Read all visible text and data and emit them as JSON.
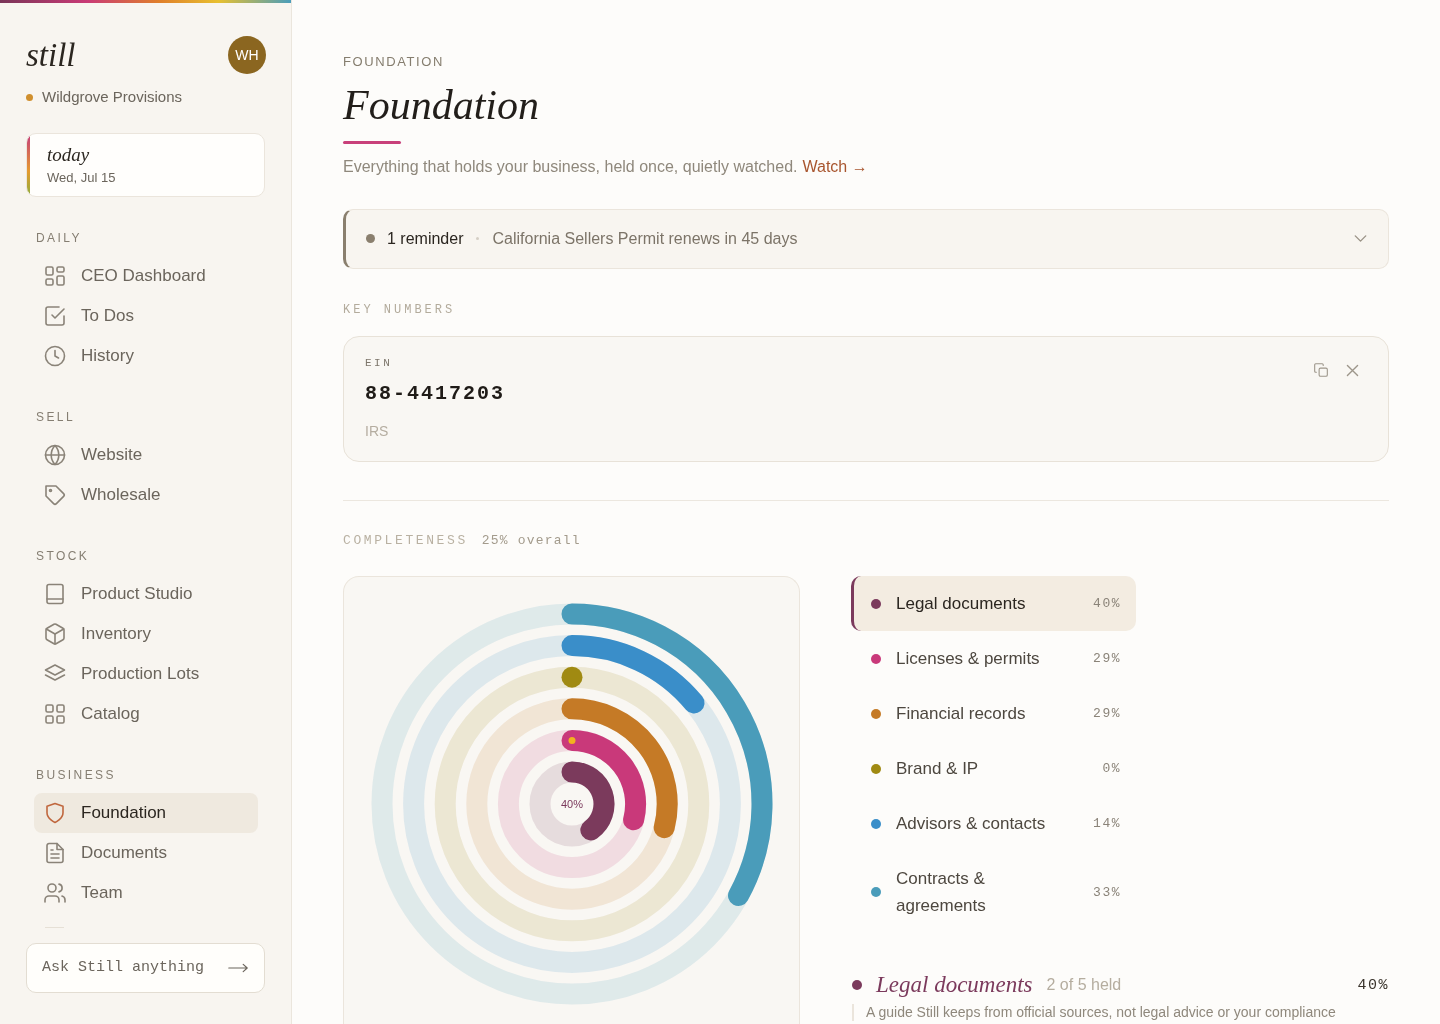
{
  "sidebar": {
    "logo": "still",
    "avatar": "WH",
    "workspace": "Wildgrove Provisions",
    "today": {
      "label": "today",
      "date": "Wed, Jul 15"
    },
    "sections": [
      {
        "title": "DAILY",
        "items": [
          {
            "label": "CEO Dashboard",
            "selected": false
          },
          {
            "label": "To Dos",
            "selected": false
          },
          {
            "label": "History",
            "selected": false
          }
        ]
      },
      {
        "title": "SELL",
        "items": [
          {
            "label": "Website",
            "selected": false
          },
          {
            "label": "Wholesale",
            "selected": false
          }
        ]
      },
      {
        "title": "STOCK",
        "items": [
          {
            "label": "Product Studio",
            "selected": false
          },
          {
            "label": "Inventory",
            "selected": false
          },
          {
            "label": "Production Lots",
            "selected": false
          },
          {
            "label": "Catalog",
            "selected": false
          }
        ]
      },
      {
        "title": "BUSINESS",
        "items": [
          {
            "label": "Foundation",
            "selected": true
          },
          {
            "label": "Documents",
            "selected": false
          },
          {
            "label": "Team",
            "selected": false
          }
        ]
      }
    ],
    "ask": {
      "placeholder": "Ask Still anything"
    }
  },
  "header": {
    "eyebrow": "FOUNDATION",
    "title": "Foundation",
    "subtitle": "Everything that holds your business, held once, quietly watched.",
    "link": "Watch →"
  },
  "reminder": {
    "count": "1 reminder",
    "text": "California Sellers Permit renews in 45 days",
    "expanded": false
  },
  "key_numbers": {
    "title": "KEY NUMBERS",
    "cards": [
      {
        "label": "EIN",
        "value": "88-4417203",
        "source": "IRS"
      }
    ]
  },
  "completeness": {
    "title": "COMPLETENESS",
    "overall": "25% overall",
    "center_label": "40%",
    "categories": [
      {
        "label": "Legal documents",
        "value": "40%",
        "color": "#7b3a5c",
        "selected": true,
        "has_reminder": false
      },
      {
        "label": "Licenses & permits",
        "value": "29%",
        "color": "#c9397a",
        "selected": false,
        "has_reminder": true
      },
      {
        "label": "Financial records",
        "value": "29%",
        "color": "#c57a26",
        "selected": false,
        "has_reminder": false
      },
      {
        "label": "Brand & IP",
        "value": "0%",
        "color": "#a08a12",
        "selected": false,
        "has_reminder": false
      },
      {
        "label": "Advisors & contacts",
        "value": "14%",
        "color": "#3a8ec9",
        "selected": false,
        "has_reminder": false
      },
      {
        "label": "Contracts & agreements",
        "value": "33%",
        "color": "#4a9cba",
        "selected": false,
        "has_reminder": false
      }
    ]
  },
  "detail": {
    "title": "Legal documents",
    "held": "2 of 5 held",
    "value": "40%",
    "note": "A guide Still keeps from official sources, not legal advice or your compliance"
  }
}
